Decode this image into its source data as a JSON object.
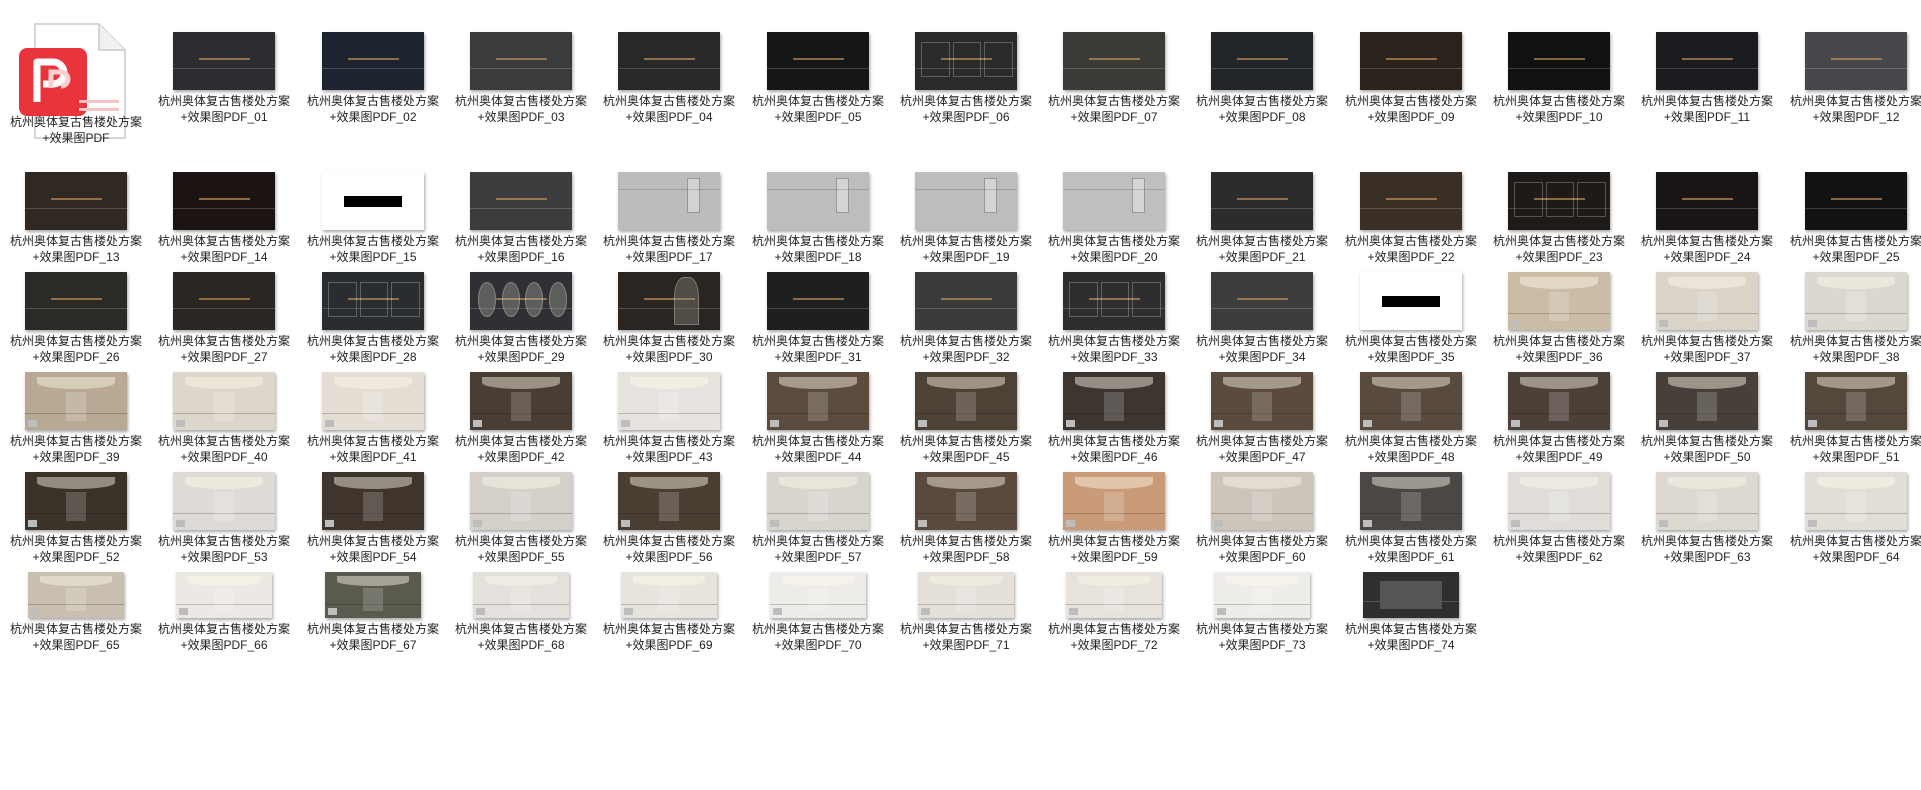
{
  "files": [
    {
      "name": "杭州奥体复古售楼处方案+效果图PDF",
      "type": "pdf-icon"
    },
    {
      "name": "杭州奥体复古售楼处方案+效果图PDF_01",
      "bg": "#2b2d30",
      "style": "dark-city"
    },
    {
      "name": "杭州奥体复古售楼处方案+效果图PDF_02",
      "bg": "#1d2430",
      "style": "dark-map"
    },
    {
      "name": "杭州奥体复古售楼处方案+效果图PDF_03",
      "bg": "#3a3b3d",
      "style": "dark-city"
    },
    {
      "name": "杭州奥体复古售楼处方案+效果图PDF_04",
      "bg": "#262829",
      "style": "dark-text"
    },
    {
      "name": "杭州奥体复古售楼处方案+效果图PDF_05",
      "bg": "#151617",
      "style": "dark-bridge"
    },
    {
      "name": "杭州奥体复古售楼处方案+效果图PDF_06",
      "bg": "#2a2a2a",
      "style": "dark-panels"
    },
    {
      "name": "杭州奥体复古售楼处方案+效果图PDF_07",
      "bg": "#3b3a36",
      "style": "dark-water"
    },
    {
      "name": "杭州奥体复古售楼处方案+效果图PDF_08",
      "bg": "#22262b",
      "style": "dark-photo"
    },
    {
      "name": "杭州奥体复古售楼处方案+效果图PDF_09",
      "bg": "#2b221c",
      "style": "dark-collage"
    },
    {
      "name": "杭州奥体复古售楼处方案+效果图PDF_10",
      "bg": "#111111",
      "style": "dark-text"
    },
    {
      "name": "杭州奥体复古售楼处方案+效果图PDF_11",
      "bg": "#1a1c20",
      "style": "dark-photo"
    },
    {
      "name": "杭州奥体复古售楼处方案+效果图PDF_12",
      "bg": "#45474a",
      "style": "dark-city"
    },
    {
      "name": "杭州奥体复古售楼处方案+效果图PDF_13",
      "bg": "#2f2823",
      "style": "dark-collage"
    },
    {
      "name": "杭州奥体复古售楼处方案+效果图PDF_14",
      "bg": "#1c1412",
      "style": "dark-text"
    },
    {
      "name": "杭州奥体复古售楼处方案+效果图PDF_15",
      "bg": "#ffffff",
      "style": "white-bar"
    },
    {
      "name": "杭州奥体复古售楼处方案+效果图PDF_16",
      "bg": "#3b3c3d",
      "style": "dark-plan"
    },
    {
      "name": "杭州奥体复古售楼处方案+效果图PDF_17",
      "bg": "#bcbcbc",
      "style": "grey-plan"
    },
    {
      "name": "杭州奥体复古售楼处方案+效果图PDF_18",
      "bg": "#bdbdbd",
      "style": "grey-plan"
    },
    {
      "name": "杭州奥体复古售楼处方案+效果图PDF_19",
      "bg": "#bdbdbd",
      "style": "grey-plan"
    },
    {
      "name": "杭州奥体复古售楼处方案+效果图PDF_20",
      "bg": "#bfbfbf",
      "style": "grey-plan"
    },
    {
      "name": "杭州奥体复古售楼处方案+效果图PDF_21",
      "bg": "#2c2c2e",
      "style": "dark-city"
    },
    {
      "name": "杭州奥体复古售楼处方案+效果图PDF_22",
      "bg": "#3a2f27",
      "style": "dark-collage"
    },
    {
      "name": "杭州奥体复古售楼处方案+效果图PDF_23",
      "bg": "#1e1a17",
      "style": "dark-panels"
    },
    {
      "name": "杭州奥体复古售楼处方案+效果图PDF_24",
      "bg": "#1a1515",
      "style": "dark-text"
    },
    {
      "name": "杭州奥体复古售楼处方案+效果图PDF_25",
      "bg": "#121214",
      "style": "dark-text"
    },
    {
      "name": "杭州奥体复古售楼处方案+效果图PDF_26",
      "bg": "#2c2a27",
      "style": "dark-collage"
    },
    {
      "name": "杭州奥体复古售楼处方案+效果图PDF_27",
      "bg": "#2c2622",
      "style": "dark-photo"
    },
    {
      "name": "杭州奥体复古售楼处方案+效果图PDF_28",
      "bg": "#2a2d30",
      "style": "dark-panels"
    },
    {
      "name": "杭州奥体复古售楼处方案+效果图PDF_29",
      "bg": "#2e3034",
      "style": "dark-circles"
    },
    {
      "name": "杭州奥体复古售楼处方案+效果图PDF_30",
      "bg": "#2b2521",
      "style": "dark-arch"
    },
    {
      "name": "杭州奥体复古售楼处方案+效果图PDF_31",
      "bg": "#1e1f21",
      "style": "dark-text"
    },
    {
      "name": "杭州奥体复古售楼处方案+效果图PDF_32",
      "bg": "#3a3a3a",
      "style": "dark-collage"
    },
    {
      "name": "杭州奥体复古售楼处方案+效果图PDF_33",
      "bg": "#2e2e30",
      "style": "dark-panels"
    },
    {
      "name": "杭州奥体复古售楼处方案+效果图PDF_34",
      "bg": "#3d3d3d",
      "style": "dark-city"
    },
    {
      "name": "杭州奥体复古售楼处方案+效果图PDF_35",
      "bg": "#ffffff",
      "style": "white-bar"
    },
    {
      "name": "杭州奥体复古售楼处方案+效果图PDF_36",
      "bg": "#cbbca6",
      "style": "render-warm"
    },
    {
      "name": "杭州奥体复古售楼处方案+效果图PDF_37",
      "bg": "#d9d3c8",
      "style": "render-light"
    },
    {
      "name": "杭州奥体复古售楼处方案+效果图PDF_38",
      "bg": "#ddd8cf",
      "style": "render-light"
    },
    {
      "name": "杭州奥体复古售楼处方案+效果图PDF_39",
      "bg": "#b7a993",
      "style": "render-warm"
    },
    {
      "name": "杭州奥体复古售楼处方案+效果图PDF_40",
      "bg": "#ddd6ca",
      "style": "render-light"
    },
    {
      "name": "杭州奥体复古售楼处方案+效果图PDF_41",
      "bg": "#e3ddd3",
      "style": "render-light"
    },
    {
      "name": "杭州奥体复古售楼处方案+效果图PDF_42",
      "bg": "#4a3d33",
      "style": "render-dark"
    },
    {
      "name": "杭州奥体复古售楼处方案+效果图PDF_43",
      "bg": "#e6e3de",
      "style": "render-light"
    },
    {
      "name": "杭州奥体复古售楼处方案+效果图PDF_44",
      "bg": "#5b4c3e",
      "style": "render-dark"
    },
    {
      "name": "杭州奥体复古售楼处方案+效果图PDF_45",
      "bg": "#4e4136",
      "style": "render-dark"
    },
    {
      "name": "杭州奥体复古售楼处方案+效果图PDF_46",
      "bg": "#3c3530",
      "style": "render-dark"
    },
    {
      "name": "杭州奥体复古售楼处方案+效果图PDF_47",
      "bg": "#5a4b3d",
      "style": "render-dark"
    },
    {
      "name": "杭州奥体复古售楼处方案+效果图PDF_48",
      "bg": "#584a3e",
      "style": "render-dark"
    },
    {
      "name": "杭州奥体复古售楼处方案+效果图PDF_49",
      "bg": "#4d4038",
      "style": "render-dark"
    },
    {
      "name": "杭州奥体复古售楼处方案+效果图PDF_50",
      "bg": "#47403a",
      "style": "render-dark"
    },
    {
      "name": "杭州奥体复古售楼处方案+效果图PDF_51",
      "bg": "#54473c",
      "style": "render-dark"
    },
    {
      "name": "杭州奥体复古售楼处方案+效果图PDF_52",
      "bg": "#3b3229",
      "style": "render-dark"
    },
    {
      "name": "杭州奥体复古售楼处方案+效果图PDF_53",
      "bg": "#dedbd6",
      "style": "render-light"
    },
    {
      "name": "杭州奥体复古售楼处方案+效果图PDF_54",
      "bg": "#3f352d",
      "style": "render-dark"
    },
    {
      "name": "杭州奥体复古售楼处方案+效果图PDF_55",
      "bg": "#d4cfc8",
      "style": "render-light"
    },
    {
      "name": "杭州奥体复古售楼处方案+效果图PDF_56",
      "bg": "#4a3e33",
      "style": "render-dark"
    },
    {
      "name": "杭州奥体复古售楼处方案+效果图PDF_57",
      "bg": "#d8d4ce",
      "style": "render-light"
    },
    {
      "name": "杭州奥体复古售楼处方案+效果图PDF_58",
      "bg": "#5a4a3e",
      "style": "render-warm"
    },
    {
      "name": "杭州奥体复古售楼处方案+效果图PDF_59",
      "bg": "#c99b78",
      "style": "render-warm"
    },
    {
      "name": "杭州奥体复古售楼处方案+效果图PDF_60",
      "bg": "#cdc4ba",
      "style": "render-light"
    },
    {
      "name": "杭州奥体复古售楼处方案+效果图PDF_61",
      "bg": "#4b4744",
      "style": "render-dark"
    },
    {
      "name": "杭州奥体复古售楼处方案+效果图PDF_62",
      "bg": "#e0ddd9",
      "style": "render-light"
    },
    {
      "name": "杭州奥体复古售楼处方案+效果图PDF_63",
      "bg": "#ddd8d0",
      "style": "render-light"
    },
    {
      "name": "杭州奥体复古售楼处方案+效果图PDF_64",
      "bg": "#e2ded7",
      "style": "render-light"
    },
    {
      "name": "杭州奥体复古售楼处方案+效果图PDF_65",
      "bg": "#c9bfae",
      "style": "render-warm",
      "w": 96
    },
    {
      "name": "杭州奥体复古售楼处方案+效果图PDF_66",
      "bg": "#ece9e4",
      "style": "render-light",
      "w": 96
    },
    {
      "name": "杭州奥体复古售楼处方案+效果图PDF_67",
      "bg": "#5a5a4f",
      "style": "render-dark",
      "w": 96
    },
    {
      "name": "杭州奥体复古售楼处方案+效果图PDF_68",
      "bg": "#e4e1dc",
      "style": "render-light",
      "w": 96
    },
    {
      "name": "杭州奥体复古售楼处方案+效果图PDF_69",
      "bg": "#e7e3dd",
      "style": "render-light",
      "w": 96
    },
    {
      "name": "杭州奥体复古售楼处方案+效果图PDF_70",
      "bg": "#eeece8",
      "style": "render-light",
      "w": 96
    },
    {
      "name": "杭州奥体复古售楼处方案+效果图PDF_71",
      "bg": "#e4dfd8",
      "style": "render-light",
      "w": 96
    },
    {
      "name": "杭州奥体复古售楼处方案+效果图PDF_72",
      "bg": "#e7e2dc",
      "style": "render-light",
      "w": 96
    },
    {
      "name": "杭州奥体复古售楼处方案+效果图PDF_73",
      "bg": "#efedea",
      "style": "render-light",
      "w": 96
    },
    {
      "name": "杭州奥体复古售楼处方案+效果图PDF_74",
      "bg": "#2f2f2f",
      "style": "dark-box",
      "w": 96
    }
  ]
}
